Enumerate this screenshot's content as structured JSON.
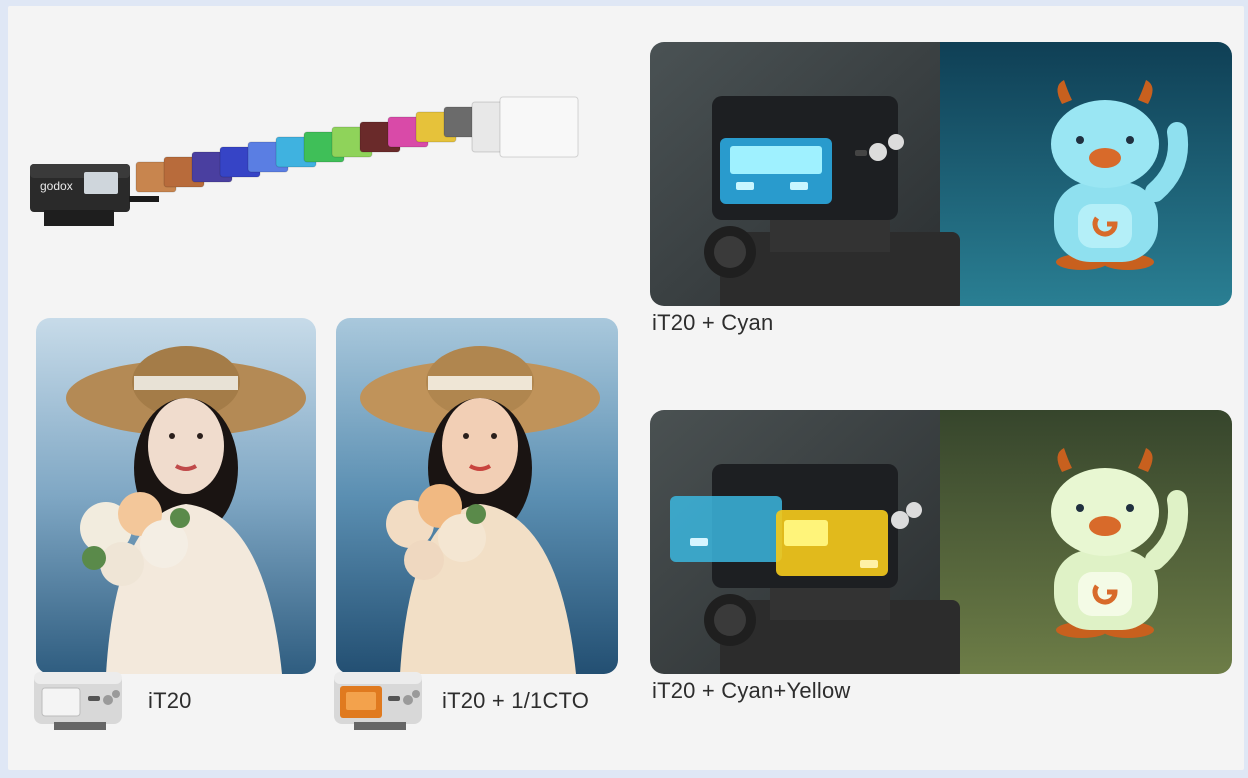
{
  "captions": {
    "cyan": "iT20 + Cyan",
    "cyan_yellow": "iT20 + Cyan+Yellow",
    "it20": "iT20",
    "cto": "iT20 + 1/1CTO"
  },
  "brand": {
    "logo_text": "godox",
    "device_label": "iT20"
  },
  "gel_colors": [
    "#c8854e",
    "#b86b3b",
    "#4a3fa0",
    "#3644c6",
    "#5a7ee3",
    "#3fb2e0",
    "#3fbf58",
    "#8fd35a",
    "#6a2a2a",
    "#d94aa8",
    "#e6c23a",
    "#6b6b6b",
    "#e8e8e8",
    "#f8f8f8"
  ],
  "accent_colors": {
    "cyan_light": "#6fd2f2",
    "cyan_yellow": "#f2c81c",
    "cto": "#e07a1f"
  }
}
